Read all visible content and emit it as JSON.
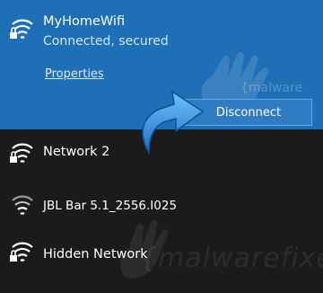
{
  "networks": [
    {
      "name": "MyHomeWifi",
      "status": "Connected, secured",
      "properties_label": "Properties",
      "disconnect_label": "Disconnect",
      "secured": true,
      "selected": true
    },
    {
      "name": "Network 2",
      "secured": true
    },
    {
      "name": "JBL Bar 5.1_2556.I025",
      "secured": false
    },
    {
      "name": "Hidden Network",
      "secured": true
    }
  ],
  "watermark": {
    "text": "{malware",
    "text2": "{malwarefixes}"
  },
  "colors": {
    "selected_bg": "#1f6fb6",
    "panel_bg": "#1b1b1b",
    "button_bg": "#2f7bc4",
    "arrow": "#2a86d6"
  }
}
